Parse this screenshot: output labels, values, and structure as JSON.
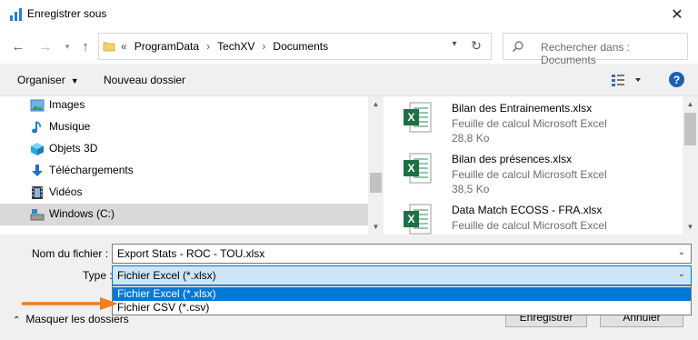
{
  "window": {
    "title": "Enregistrer sous",
    "close_label": "✕"
  },
  "address": {
    "crumbs": [
      "ProgramData",
      "TechXV",
      "Documents"
    ],
    "prefix": "«"
  },
  "search": {
    "placeholder": "Rechercher dans : Documents"
  },
  "toolbar": {
    "organize_label": "Organiser",
    "new_folder_label": "Nouveau dossier",
    "help_label": "?"
  },
  "nav": {
    "items": [
      {
        "label": "Images",
        "icon": "images-icon"
      },
      {
        "label": "Musique",
        "icon": "music-icon"
      },
      {
        "label": "Objets 3D",
        "icon": "3d-objects-icon"
      },
      {
        "label": "Téléchargements",
        "icon": "downloads-icon"
      },
      {
        "label": "Vidéos",
        "icon": "videos-icon"
      },
      {
        "label": "Windows (C:)",
        "icon": "drive-icon",
        "selected": true
      }
    ]
  },
  "files": [
    {
      "name": "Bilan des Entrainements.xlsx",
      "type": "Feuille de calcul Microsoft Excel",
      "size": "28,8 Ko"
    },
    {
      "name": "Bilan des présences.xlsx",
      "type": "Feuille de calcul Microsoft Excel",
      "size": "38,5 Ko"
    },
    {
      "name": "Data Match ECOSS - FRA.xlsx",
      "type": "Feuille de calcul Microsoft Excel",
      "size": ""
    }
  ],
  "form": {
    "filename_label": "Nom du fichier :",
    "filename_value": "Export Stats - ROC - TOU.xlsx",
    "type_label": "Type :",
    "type_value": "Fichier Excel (*.xlsx)",
    "type_options": [
      "Fichier Excel (*.xlsx)",
      "Fichier CSV (*.csv)"
    ],
    "hide_folders_label": "Masquer les dossiers",
    "save_label": "Enregistrer",
    "cancel_label": "Annuler"
  },
  "colors": {
    "accent": "#0078d7",
    "excel_green": "#1e7145",
    "arrow": "#f07d1e"
  }
}
